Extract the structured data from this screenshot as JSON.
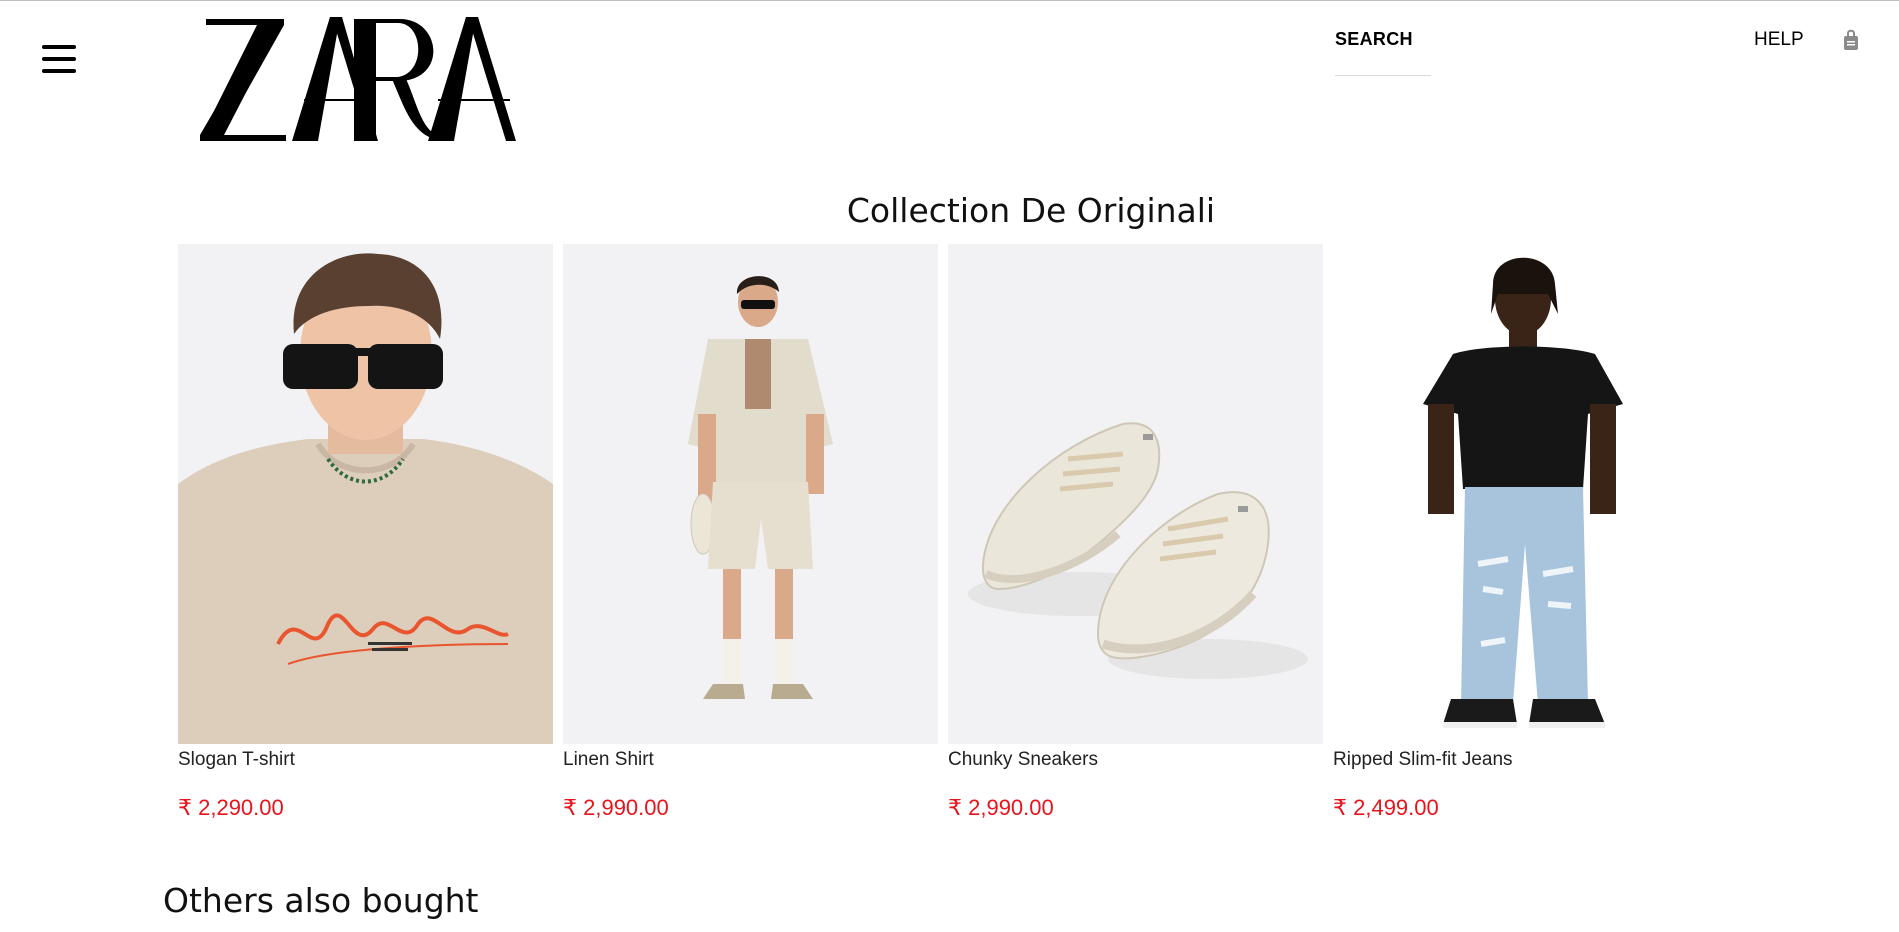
{
  "header": {
    "logo_text": "ZARA",
    "search_label": "SEARCH",
    "help_label": "HELP",
    "menu_icon": "hamburger-menu-icon",
    "bag_icon": "shopping-bag-icon"
  },
  "collection": {
    "title": "Collection De Originali",
    "products": [
      {
        "name": "Slogan T-shirt",
        "price": "₹ 2,290.00"
      },
      {
        "name": "Linen Shirt",
        "price": "₹ 2,990.00"
      },
      {
        "name": "Chunky Sneakers",
        "price": "₹ 2,990.00"
      },
      {
        "name": "Ripped Slim-fit Jeans",
        "price": "₹ 2,499.00"
      }
    ]
  },
  "others": {
    "title": "Others also bought"
  },
  "colors": {
    "price": "#e8141b",
    "text": "#111111",
    "image_bg": "#f3f3f5"
  }
}
